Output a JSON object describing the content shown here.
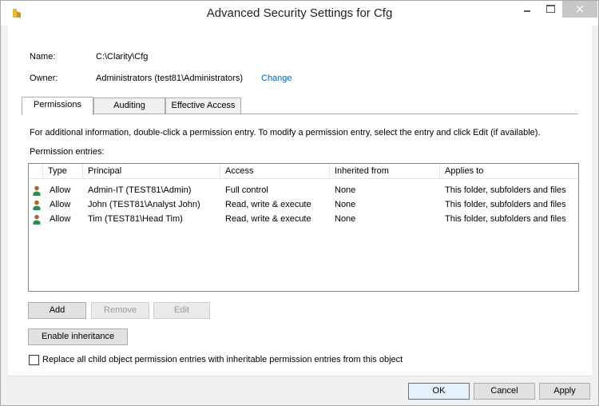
{
  "window": {
    "title": "Advanced Security Settings for Cfg",
    "close_glyph": "×"
  },
  "info": {
    "name_label": "Name:",
    "name_value": "C:\\Clarity\\Cfg",
    "owner_label": "Owner:",
    "owner_value": "Administrators (test81\\Administrators)",
    "change_link": "Change"
  },
  "tabs": [
    {
      "label": "Permissions",
      "active": true
    },
    {
      "label": "Auditing",
      "active": false
    },
    {
      "label": "Effective Access",
      "active": false
    }
  ],
  "instructions": "For additional information, double-click a permission entry. To modify a permission entry, select the entry and click Edit (if available).",
  "entries_label": "Permission entries:",
  "table": {
    "columns": [
      "Type",
      "Principal",
      "Access",
      "Inherited from",
      "Applies to"
    ],
    "rows": [
      {
        "icon": "user-icon",
        "type": "Allow",
        "principal": "Admin-IT (TEST81\\Admin)",
        "access": "Full control",
        "inherited": "None",
        "applies": "This folder, subfolders and files"
      },
      {
        "icon": "user-icon",
        "type": "Allow",
        "principal": "John (TEST81\\Analyst John)",
        "access": "Read, write & execute",
        "inherited": "None",
        "applies": "This folder, subfolders and files"
      },
      {
        "icon": "user-icon",
        "type": "Allow",
        "principal": "Tim (TEST81\\Head Tim)",
        "access": "Read, write & execute",
        "inherited": "None",
        "applies": "This folder, subfolders and files"
      }
    ]
  },
  "buttons": {
    "add": "Add",
    "remove": "Remove",
    "edit": "Edit",
    "enable_inheritance": "Enable inheritance",
    "ok": "OK",
    "cancel": "Cancel",
    "apply": "Apply"
  },
  "replace_checkbox": {
    "label": "Replace all child object permission entries with inheritable permission entries from this object",
    "checked": false
  },
  "colors": {
    "link": "#0066cc",
    "close_button": "#c7c7c7"
  }
}
